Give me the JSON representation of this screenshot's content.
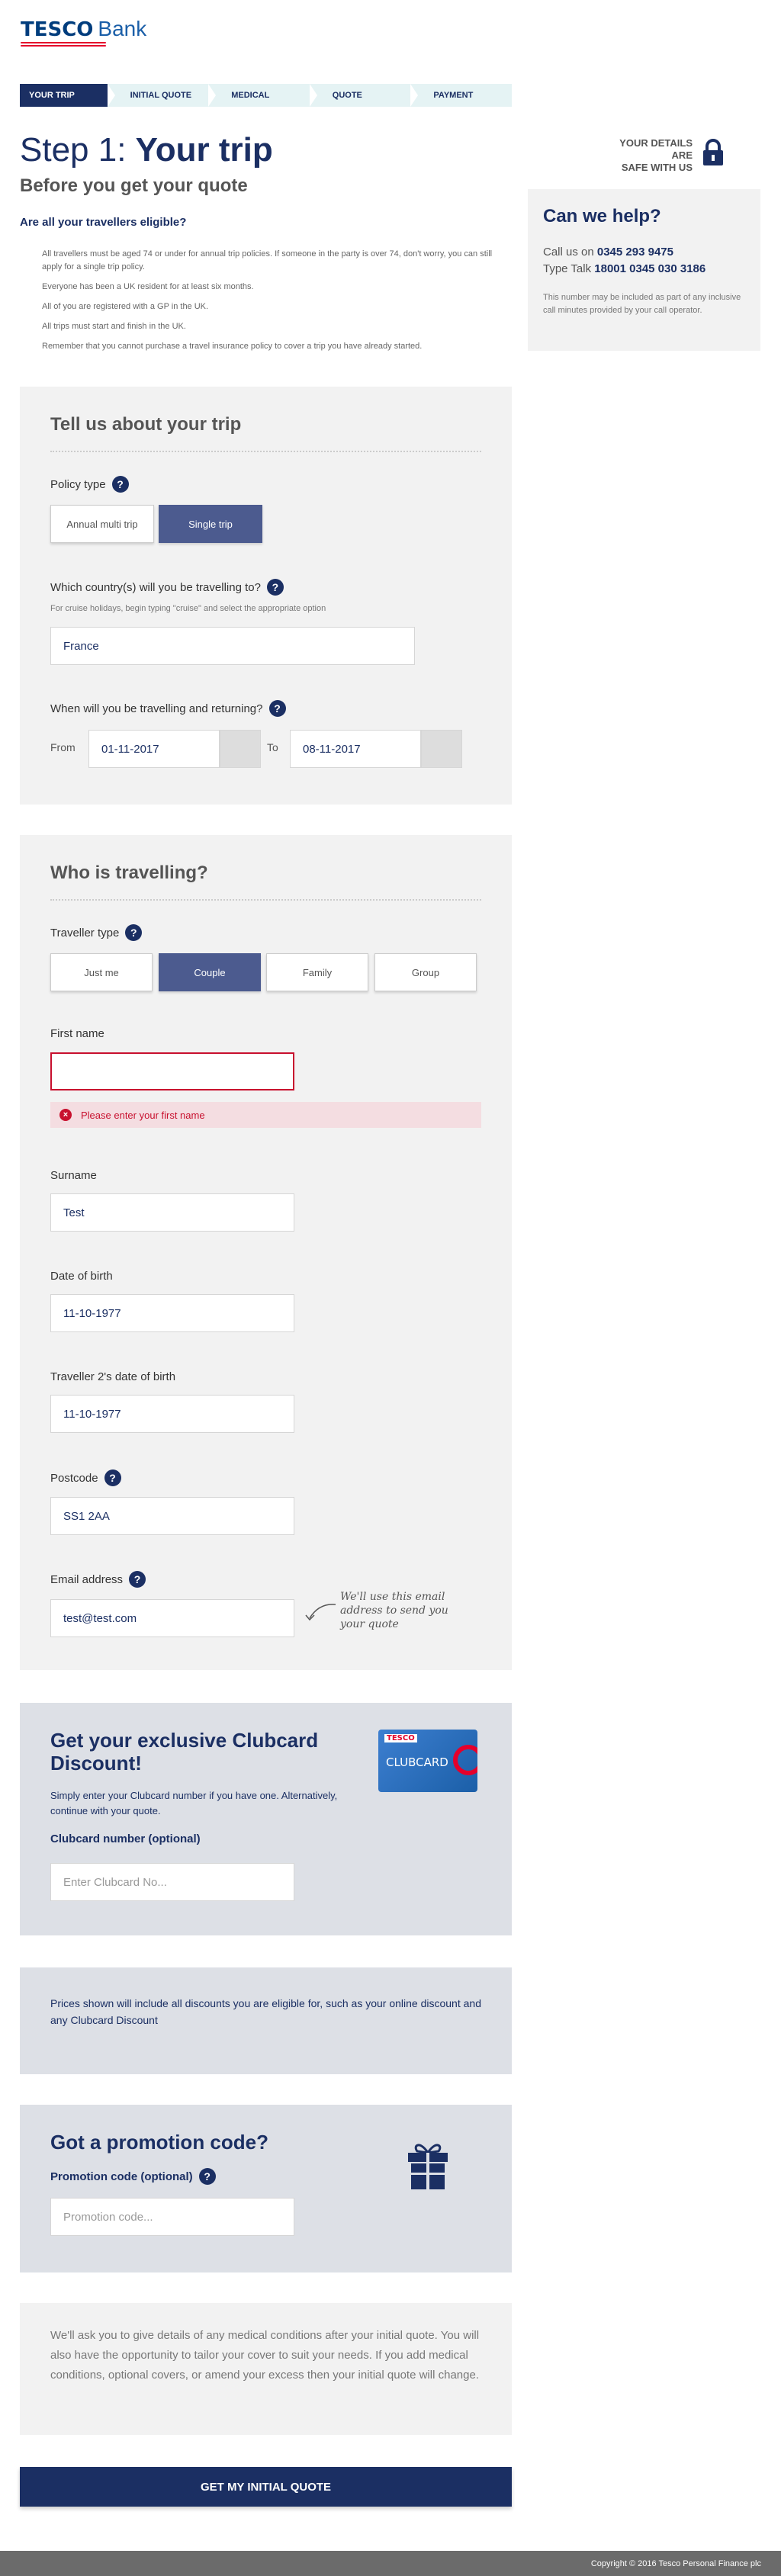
{
  "brand": {
    "name": "TESCO",
    "product": "Bank"
  },
  "progress_steps": [
    "YOUR TRIP",
    "INITIAL QUOTE",
    "MEDICAL",
    "QUOTE",
    "PAYMENT"
  ],
  "heading": {
    "step_prefix": "Step 1:",
    "step_name": "Your trip",
    "subtitle": "Before you get your quote"
  },
  "safe_badge": {
    "line1": "YOUR DETAILS ARE",
    "line2": "SAFE WITH US"
  },
  "eligibility": {
    "question": "Are all your travellers eligible?",
    "rules": [
      "All travellers must be aged 74 or under for annual trip policies. If someone in the party is over 74, don't worry, you can still apply for a single trip policy.",
      "Everyone has been a UK resident for at least six months.",
      "All of you are registered with a GP in the UK.",
      "All trips must start and finish in the UK.",
      "Remember that you cannot purchase a travel insurance policy to cover a trip you have already started."
    ]
  },
  "help": {
    "title": "Can we help?",
    "call_label": "Call us on",
    "call_number": "0345 293 9475",
    "talk_label": "Type Talk",
    "talk_number": "18001 0345 030 3186",
    "note": "This number may be included as part of any inclusive call minutes provided by your call operator."
  },
  "trip": {
    "title": "Tell us about your trip",
    "policy_type_label": "Policy type",
    "policy_options": [
      "Annual multi trip",
      "Single trip"
    ],
    "country_label": "Which country(s) will you be travelling to?",
    "country_hint": "For cruise holidays, begin typing \"cruise\" and select the appropriate option",
    "country_value": "France",
    "dates_label": "When will you be travelling and returning?",
    "from_label": "From",
    "from_value": "01-11-2017",
    "to_label": "To",
    "to_value": "08-11-2017"
  },
  "travellers": {
    "title": "Who is travelling?",
    "type_label": "Traveller type",
    "type_options": [
      "Just me",
      "Couple",
      "Family",
      "Group"
    ],
    "first_name_label": "First name",
    "first_name_value": "",
    "first_name_error": "Please enter your first name",
    "surname_label": "Surname",
    "surname_value": "Test",
    "dob_label": "Date of birth",
    "dob_value": "11-10-1977",
    "dob2_label": "Traveller 2's date of birth",
    "dob2_value": "11-10-1977",
    "postcode_label": "Postcode",
    "postcode_value": "SS1 2AA",
    "email_label": "Email address",
    "email_value": "test@test.com",
    "email_note": "We'll use this email address to send you your quote"
  },
  "clubcard": {
    "title": "Get your exclusive Clubcard Discount!",
    "text": "Simply enter your Clubcard number if you have one. Alternatively, continue with your quote.",
    "field_label": "Clubcard number (optional)",
    "placeholder": "Enter Clubcard No...",
    "card_brand": "TESCO",
    "card_name": "CLUBCARD"
  },
  "discount_info": "Prices shown will include all discounts you are eligible for, such as your online discount and any Clubcard Discount",
  "promo": {
    "title": "Got a promotion code?",
    "field_label": "Promotion code (optional)",
    "placeholder": "Promotion code..."
  },
  "medical_note": "We'll ask you to give details of any medical conditions after your initial quote. You will also have the opportunity to tailor your cover to suit your needs. If you add medical conditions, optional covers, or amend your excess then your initial quote will change.",
  "cta_label": "GET MY INITIAL QUOTE",
  "footer": "Copyright © 2016 Tesco Personal Finance plc",
  "colors": {
    "navy": "#1b2f63",
    "selected": "#4c5b8f",
    "error": "#c8102e",
    "step_bg": "#e5f3f4"
  }
}
